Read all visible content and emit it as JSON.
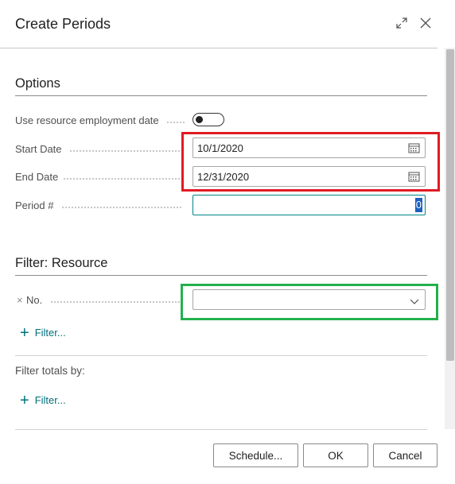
{
  "dialog": {
    "title": "Create Periods",
    "expand_icon": "expand-icon",
    "close_icon": "close-icon"
  },
  "options": {
    "section_title": "Options",
    "use_employment_label": "Use resource employment date",
    "use_employment_value": false,
    "start_date_label": "Start Date",
    "start_date_value": "10/1/2020",
    "end_date_label": "End Date",
    "end_date_value": "12/31/2020",
    "period_label": "Period #",
    "period_value": "0"
  },
  "filter_resource": {
    "section_title": "Filter: Resource",
    "no_remove_glyph": "×",
    "no_label": "No.",
    "no_value": "",
    "add_filter_label": "Filter..."
  },
  "filter_totals": {
    "label": "Filter totals by:",
    "add_filter_label": "Filter..."
  },
  "footer": {
    "schedule_label": "Schedule...",
    "ok_label": "OK",
    "cancel_label": "Cancel"
  },
  "annotations": {
    "red_box_color": "#e01b24",
    "green_box_color": "#22b14c"
  },
  "colors": {
    "accent": "#008489",
    "link": "#00707a"
  }
}
